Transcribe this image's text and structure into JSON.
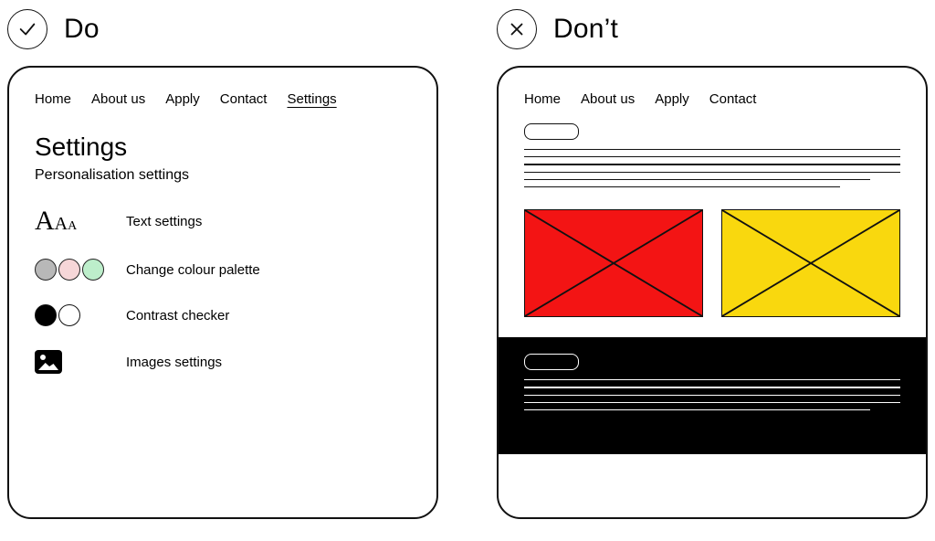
{
  "labels": {
    "do": "Do",
    "dont": "Don’t"
  },
  "left": {
    "nav": [
      "Home",
      "About us",
      "Apply",
      "Contact",
      "Settings"
    ],
    "active_nav_index": 4,
    "title": "Settings",
    "subtitle": "Personalisation settings",
    "options": [
      {
        "key": "text",
        "label": "Text settings"
      },
      {
        "key": "palette",
        "label": "Change colour palette"
      },
      {
        "key": "contrast",
        "label": "Contrast checker"
      },
      {
        "key": "images",
        "label": "Images settings"
      }
    ],
    "palette_colors": [
      "#b8b8b8",
      "#f6d6d8",
      "#bdeecb"
    ]
  },
  "right": {
    "nav": [
      "Home",
      "About us",
      "Apply",
      "Contact"
    ],
    "tile_colors": [
      "#f31414",
      "#f9d80e"
    ]
  }
}
